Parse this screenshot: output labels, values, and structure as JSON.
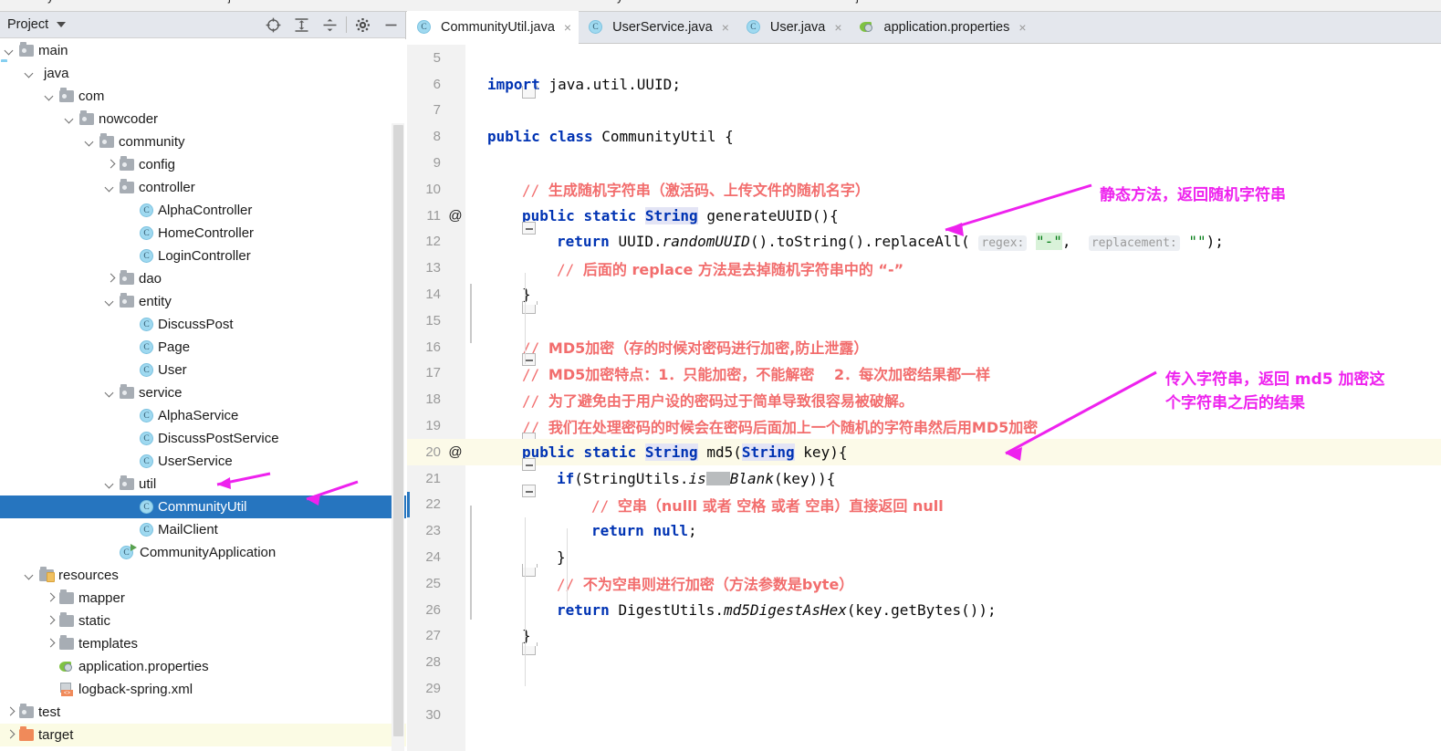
{
  "top_strip": {
    "breadcrumb_fragments": [
      "y",
      "j",
      "y",
      "j",
      "j",
      "j"
    ]
  },
  "colors": {
    "selection_blue": "#2675bf",
    "annotation_magenta": "#ee22ee",
    "comment_red": "#f26d6d",
    "keyword_blue": "#0033b3",
    "string_green": "#067d17",
    "excluded_yellow": "#fbfbe4",
    "current_line_yellow": "#fcfae8",
    "toolwindow_header": "#e4e7ed"
  },
  "project_panel": {
    "title": "Project",
    "toolbar": [
      {
        "name": "locate-in-tree-icon",
        "glyph": "target"
      },
      {
        "name": "expand-all-icon",
        "glyph": "expand"
      },
      {
        "name": "collapse-all-icon",
        "glyph": "collapse"
      },
      {
        "name": "gear-icon",
        "glyph": "gear"
      },
      {
        "name": "hide-icon",
        "glyph": "minus"
      }
    ],
    "tree": [
      {
        "label": "main",
        "indent": 1,
        "arrow": "down",
        "icon": "folder-src",
        "type": "folder"
      },
      {
        "label": "java",
        "indent": 2,
        "arrow": "down",
        "icon": "folder-java",
        "type": "folder"
      },
      {
        "label": "com",
        "indent": 3,
        "arrow": "down",
        "icon": "folder-package",
        "type": "package"
      },
      {
        "label": "nowcoder",
        "indent": 4,
        "arrow": "down",
        "icon": "folder-package",
        "type": "package"
      },
      {
        "label": "community",
        "indent": 5,
        "arrow": "down",
        "icon": "folder-package",
        "type": "package"
      },
      {
        "label": "config",
        "indent": 6,
        "arrow": "right",
        "icon": "folder-package",
        "type": "package"
      },
      {
        "label": "controller",
        "indent": 6,
        "arrow": "down",
        "icon": "folder-package",
        "type": "package"
      },
      {
        "label": "AlphaController",
        "indent": 7,
        "arrow": "none",
        "icon": "java-class",
        "type": "class"
      },
      {
        "label": "HomeController",
        "indent": 7,
        "arrow": "none",
        "icon": "java-class",
        "type": "class"
      },
      {
        "label": "LoginController",
        "indent": 7,
        "arrow": "none",
        "icon": "java-class",
        "type": "class"
      },
      {
        "label": "dao",
        "indent": 6,
        "arrow": "right",
        "icon": "folder-package",
        "type": "package"
      },
      {
        "label": "entity",
        "indent": 6,
        "arrow": "down",
        "icon": "folder-package",
        "type": "package"
      },
      {
        "label": "DiscussPost",
        "indent": 7,
        "arrow": "none",
        "icon": "java-class",
        "type": "class"
      },
      {
        "label": "Page",
        "indent": 7,
        "arrow": "none",
        "icon": "java-class",
        "type": "class"
      },
      {
        "label": "User",
        "indent": 7,
        "arrow": "none",
        "icon": "java-class",
        "type": "class"
      },
      {
        "label": "service",
        "indent": 6,
        "arrow": "down",
        "icon": "folder-package",
        "type": "package"
      },
      {
        "label": "AlphaService",
        "indent": 7,
        "arrow": "none",
        "icon": "java-class",
        "type": "class"
      },
      {
        "label": "DiscussPostService",
        "indent": 7,
        "arrow": "none",
        "icon": "java-class",
        "type": "class"
      },
      {
        "label": "UserService",
        "indent": 7,
        "arrow": "none",
        "icon": "java-class",
        "type": "class"
      },
      {
        "label": "util",
        "indent": 6,
        "arrow": "down",
        "icon": "folder-package",
        "type": "package"
      },
      {
        "label": "CommunityUtil",
        "indent": 7,
        "arrow": "none",
        "icon": "java-class",
        "type": "class",
        "selected": true
      },
      {
        "label": "MailClient",
        "indent": 7,
        "arrow": "none",
        "icon": "java-class",
        "type": "class"
      },
      {
        "label": "CommunityApplication",
        "indent": 6,
        "arrow": "none",
        "icon": "spring-class",
        "type": "class"
      },
      {
        "label": "resources",
        "indent": 2,
        "arrow": "down",
        "icon": "folder-resource",
        "type": "folder"
      },
      {
        "label": "mapper",
        "indent": 3,
        "arrow": "right",
        "icon": "folder-plain",
        "type": "folder"
      },
      {
        "label": "static",
        "indent": 3,
        "arrow": "right",
        "icon": "folder-plain",
        "type": "folder"
      },
      {
        "label": "templates",
        "indent": 3,
        "arrow": "right",
        "icon": "folder-plain",
        "type": "folder"
      },
      {
        "label": "application.properties",
        "indent": 3,
        "arrow": "none",
        "icon": "spring-props",
        "type": "file"
      },
      {
        "label": "logback-spring.xml",
        "indent": 3,
        "arrow": "none",
        "icon": "xml-file",
        "type": "file"
      },
      {
        "label": "test",
        "indent": 1,
        "arrow": "right",
        "icon": "folder-src",
        "type": "folder"
      },
      {
        "label": "target",
        "indent": 1,
        "arrow": "right",
        "icon": "folder-target",
        "type": "folder",
        "excluded": true
      }
    ]
  },
  "editor": {
    "tabs": [
      {
        "label": "CommunityUtil.java",
        "icon": "java-class",
        "active": true,
        "close": "×"
      },
      {
        "label": "UserService.java",
        "icon": "java-class",
        "active": false,
        "close": "×"
      },
      {
        "label": "User.java",
        "icon": "java-class",
        "active": false,
        "close": "×"
      },
      {
        "label": "application.properties",
        "icon": "spring-props",
        "active": false,
        "close": "×"
      }
    ],
    "file_name": "CommunityUtil.java",
    "lines": [
      {
        "n": "5",
        "at": "",
        "fold": "",
        "kind": "blank",
        "text": ""
      },
      {
        "n": "6",
        "at": "",
        "fold": "tail-up",
        "kind": "code",
        "text": "import java.util.UUID;"
      },
      {
        "n": "7",
        "at": "",
        "fold": "",
        "kind": "blank",
        "text": ""
      },
      {
        "n": "8",
        "at": "",
        "fold": "",
        "kind": "code",
        "text": "public class CommunityUtil {"
      },
      {
        "n": "9",
        "at": "",
        "fold": "",
        "kind": "blank",
        "text": ""
      },
      {
        "n": "10",
        "at": "",
        "fold": "",
        "kind": "comment",
        "text": "// 生成随机字符串（激活码、上传文件的随机名字）"
      },
      {
        "n": "11",
        "at": "@",
        "fold": "open",
        "kind": "code",
        "text": "public static String generateUUID(){"
      },
      {
        "n": "12",
        "at": "",
        "fold": "",
        "kind": "code",
        "text": "return UUID.randomUUID().toString().replaceAll( regex: \"-\",  replacement: \"\");"
      },
      {
        "n": "13",
        "at": "",
        "fold": "",
        "kind": "comment",
        "text": "// 后面的 replace 方法是去掉随机字符串中的 “-”"
      },
      {
        "n": "14",
        "at": "",
        "fold": "tail",
        "kind": "code",
        "text": "}"
      },
      {
        "n": "15",
        "at": "",
        "fold": "",
        "kind": "blank",
        "text": ""
      },
      {
        "n": "16",
        "at": "",
        "fold": "open",
        "kind": "comment",
        "text": "// MD5加密（存的时候对密码进行加密,防止泄露）"
      },
      {
        "n": "17",
        "at": "",
        "fold": "",
        "kind": "comment",
        "text": "// MD5加密特点：1．只能加密，不能解密　 2．每次加密结果都一样"
      },
      {
        "n": "18",
        "at": "",
        "fold": "",
        "kind": "comment",
        "text": "// 为了避免由于用户设的密码过于简单导致很容易被破解。"
      },
      {
        "n": "19",
        "at": "",
        "fold": "open",
        "kind": "comment",
        "text": "// 我们在处理密码的时候会在密码后面加上一个随机的字符串然后用MD5加密"
      },
      {
        "n": "20",
        "at": "@",
        "fold": "open",
        "kind": "code",
        "text": "public static String md5(String key){",
        "highlight": true
      },
      {
        "n": "21",
        "at": "",
        "fold": "open",
        "kind": "code",
        "text": "if(StringUtils.is██Blank(key)){"
      },
      {
        "n": "22",
        "at": "",
        "fold": "",
        "kind": "comment",
        "text": "// 空串（nulll 或者 空格 或者 空串）直接返回 null",
        "caret": true
      },
      {
        "n": "23",
        "at": "",
        "fold": "",
        "kind": "code",
        "text": "return null;"
      },
      {
        "n": "24",
        "at": "",
        "fold": "tail",
        "kind": "code",
        "text": "}"
      },
      {
        "n": "25",
        "at": "",
        "fold": "",
        "kind": "comment",
        "text": "// 不为空串则进行加密（方法参数是byte）"
      },
      {
        "n": "26",
        "at": "",
        "fold": "",
        "kind": "code",
        "text": "return DigestUtils.md5DigestAsHex(key.getBytes());"
      },
      {
        "n": "27",
        "at": "",
        "fold": "tail",
        "kind": "code",
        "text": "}"
      },
      {
        "n": "28",
        "at": "",
        "fold": "",
        "kind": "blank",
        "text": ""
      },
      {
        "n": "29",
        "at": "",
        "fold": "",
        "kind": "blank",
        "text": ""
      },
      {
        "n": "30",
        "at": "",
        "fold": "",
        "kind": "blank",
        "text": ""
      }
    ],
    "inlay_hints": {
      "regex": "regex:",
      "replacement": "replacement:"
    }
  },
  "annotations": [
    {
      "id": "anno-1",
      "text": "静态方法，返回随机字符串"
    },
    {
      "id": "anno-2",
      "text": "传入字符串，返回 md5 加密这\n个字符串之后的结果"
    }
  ]
}
